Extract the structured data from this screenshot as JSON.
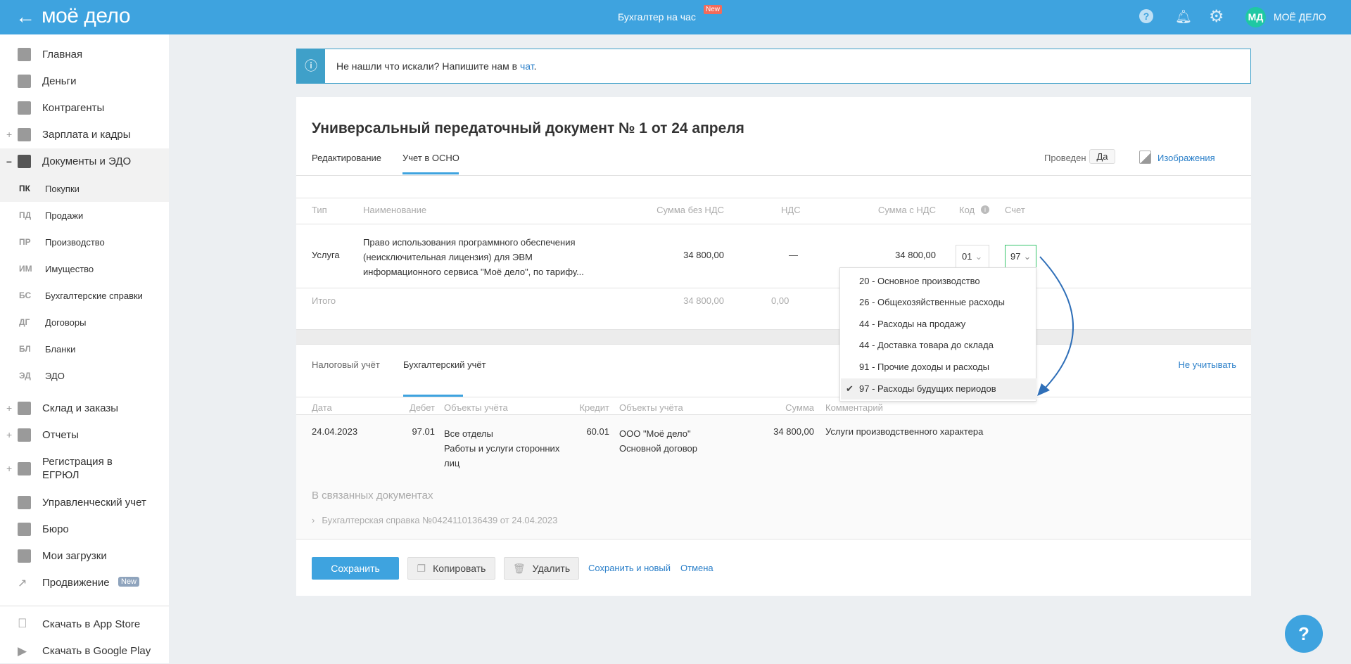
{
  "header": {
    "logo": "моё дело",
    "center_title": "Бухгалтер на час",
    "new_badge": "New",
    "avatar_initials": "МД",
    "org_name": "МОЁ ДЕЛО"
  },
  "sidebar": {
    "items": [
      {
        "label": "Главная",
        "icon": "home-icon"
      },
      {
        "label": "Деньги",
        "icon": "money-icon"
      },
      {
        "label": "Контрагенты",
        "icon": "contractors-icon"
      },
      {
        "label": "Зарплата и кадры",
        "icon": "salary-icon",
        "expand": "+"
      },
      {
        "label": "Документы и ЭДО",
        "icon": "folder-icon",
        "expand": "–"
      }
    ],
    "sub_items": [
      {
        "abbr": "ПК",
        "label": "Покупки"
      },
      {
        "abbr": "ПД",
        "label": "Продажи"
      },
      {
        "abbr": "ПР",
        "label": "Производство"
      },
      {
        "abbr": "ИМ",
        "label": "Имущество"
      },
      {
        "abbr": "БС",
        "label": "Бухгалтерские справки"
      },
      {
        "abbr": "ДГ",
        "label": "Договоры"
      },
      {
        "abbr": "БЛ",
        "label": "Бланки"
      },
      {
        "abbr": "ЭД",
        "label": "ЭДО"
      }
    ],
    "items2": [
      {
        "label": "Склад и заказы",
        "expand": "+"
      },
      {
        "label": "Отчеты",
        "expand": "+"
      },
      {
        "label": "Регистрация в ЕГРЮЛ",
        "expand": "+"
      },
      {
        "label": "Управленческий учет"
      },
      {
        "label": "Бюро"
      },
      {
        "label": "Мои загрузки"
      },
      {
        "label": "Продвижение",
        "badge": "New"
      }
    ],
    "apps": [
      {
        "label": "Скачать в App Store"
      },
      {
        "label": "Скачать в Google Play"
      }
    ]
  },
  "info": {
    "text": "Не нашли что искали? Напишите нам в ",
    "link": "чат",
    "end": "."
  },
  "doc": {
    "title": "Универсальный передаточный документ № 1 от 24 апреля",
    "tabs": [
      "Редактирование",
      "Учет в ОСНО"
    ],
    "posted_label": "Проведен",
    "posted_value": "Да",
    "images_link": "Изображения",
    "table": {
      "headers": [
        "Тип",
        "Наименование",
        "Сумма без НДС",
        "НДС",
        "Сумма с НДС",
        "Код",
        "Счет"
      ],
      "row": {
        "type": "Услуга",
        "name": [
          "Право использования программного обеспечения",
          "(неисключительная лицензия) для ЭВМ",
          "информационного сервиса \"Моё дело\", по тарифу..."
        ],
        "sum_wo_vat": "34 800,00",
        "vat": "—",
        "sum_w_vat": "34 800,00",
        "code": "01",
        "account": "97"
      },
      "total": {
        "label": "Итого",
        "sum_wo_vat": "34 800,00",
        "vat": "0,00"
      }
    },
    "account_dropdown": {
      "options": [
        "20 - Основное производство",
        "26 - Общехозяйственные расходы",
        "44 - Расходы на продажу",
        "44 - Доставка товара до склада",
        "91 - Прочие доходы и расходы",
        "97 - Расходы будущих периодов"
      ],
      "selected_index": 5
    }
  },
  "ledger": {
    "tabs": [
      "Налоговый учёт",
      "Бухгалтерский учёт"
    ],
    "ignore_link": "Не учитывать",
    "headers": [
      "Дата",
      "Дебет",
      "Объекты учёта",
      "Кредит",
      "Объекты учёта",
      "Сумма",
      "Комментарий"
    ],
    "row": {
      "date": "24.04.2023",
      "debit": "97.01",
      "debit_objects": [
        "Все отделы",
        "Работы и услуги сторонних",
        "лиц"
      ],
      "credit": "60.01",
      "credit_objects": [
        "ООО \"Моё дело\"",
        "Основной договор"
      ],
      "sum": "34 800,00",
      "comment": "Услуги производственного характера"
    },
    "related_title": "В связанных документах",
    "related_doc": "Бухгалтерская справка №0424110136439 от 24.04.2023"
  },
  "footer": {
    "save": "Сохранить",
    "copy": "Копировать",
    "delete": "Удалить",
    "save_new": "Сохранить и новый",
    "cancel": "Отмена"
  },
  "colors": {
    "header": "#3ea3df",
    "accent": "#3ea3df",
    "link": "#2a7fc9",
    "avatar": "#1fc8a3",
    "badge": "#f26b5b"
  }
}
